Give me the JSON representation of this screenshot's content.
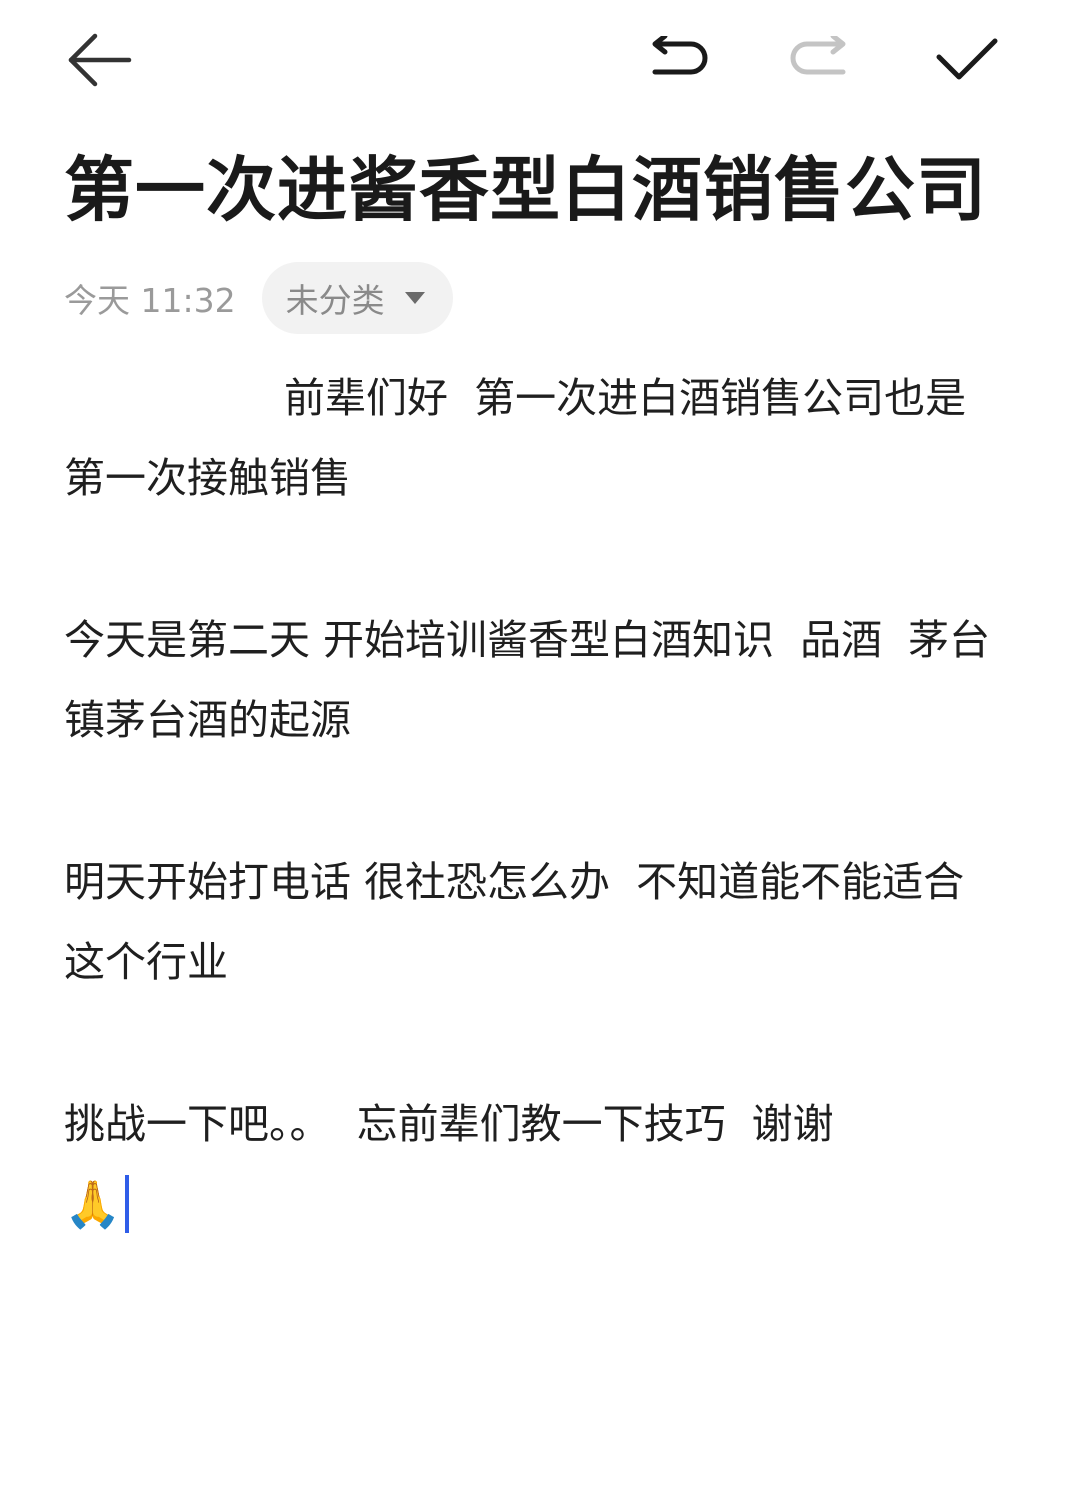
{
  "toolbar": {
    "back_icon": "arrow-left-icon",
    "undo_icon": "undo-icon",
    "redo_icon": "redo-icon",
    "done_icon": "checkmark-icon"
  },
  "note": {
    "title": "第一次进酱香型白酒销售公司",
    "time": "今天 11:32",
    "category": "未分类",
    "paragraphs": [
      "前辈们好  第一次进白酒销售公司也是第一次接触销售",
      "今天是第二天 开始培训酱香型白酒知识  品酒  茅台镇茅台酒的起源",
      "明天开始打电话 很社恐怎么办  不知道能不能适合这个行业",
      "挑战一下吧。。  忘前辈们教一下技巧  谢谢"
    ],
    "emoji": "🙏"
  },
  "colors": {
    "accent_cursor": "#2f5de8",
    "text": "#1f1f1f",
    "meta": "#9a9a9a",
    "chip_bg": "#f2f2f2"
  }
}
